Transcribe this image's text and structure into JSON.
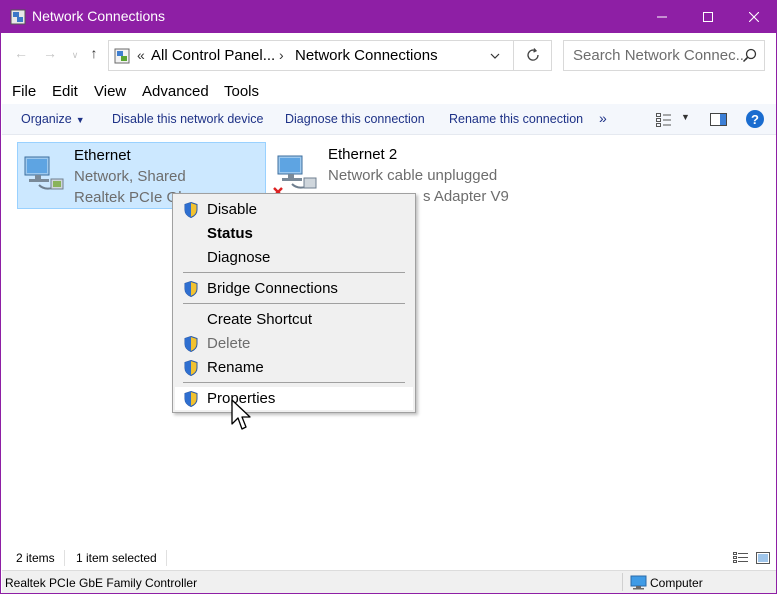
{
  "window": {
    "title": "Network Connections",
    "accent_color": "#8e1fa5"
  },
  "address": {
    "crumbs": [
      "All Control Panel...",
      "Network Connections"
    ],
    "search_placeholder": "Search Network Connec..."
  },
  "menu": [
    "File",
    "Edit",
    "View",
    "Advanced",
    "Tools"
  ],
  "commands": {
    "organize": "Organize",
    "disable": "Disable this network device",
    "diagnose": "Diagnose this connection",
    "rename": "Rename this connection",
    "more": "»"
  },
  "connections": [
    {
      "name": "Ethernet",
      "status": "Network, Shared",
      "device": "Realtek PCIe GbE Family Controller",
      "device_visible": "Realtek PCIe Gb",
      "selected": true,
      "icon": "network-adapter-icon"
    },
    {
      "name": "Ethernet 2",
      "status": "Network cable unplugged",
      "device_visible": "s Adapter V9",
      "selected": false,
      "icon": "network-adapter-unplugged-icon"
    }
  ],
  "context_menu": {
    "items": [
      {
        "label": "Disable",
        "shield": true
      },
      {
        "label": "Status",
        "bold": true
      },
      {
        "label": "Diagnose"
      },
      {
        "label": "Bridge Connections",
        "shield": true
      },
      {
        "label": "Create Shortcut"
      },
      {
        "label": "Delete",
        "shield": true,
        "disabled": true
      },
      {
        "label": "Rename",
        "shield": true
      },
      {
        "label": "Properties",
        "shield": true,
        "hover": true
      }
    ]
  },
  "status": {
    "items_count": "2 items",
    "selected_count": "1 item selected"
  },
  "info": {
    "device": "Realtek PCIe GbE Family Controller",
    "location": "Computer"
  }
}
